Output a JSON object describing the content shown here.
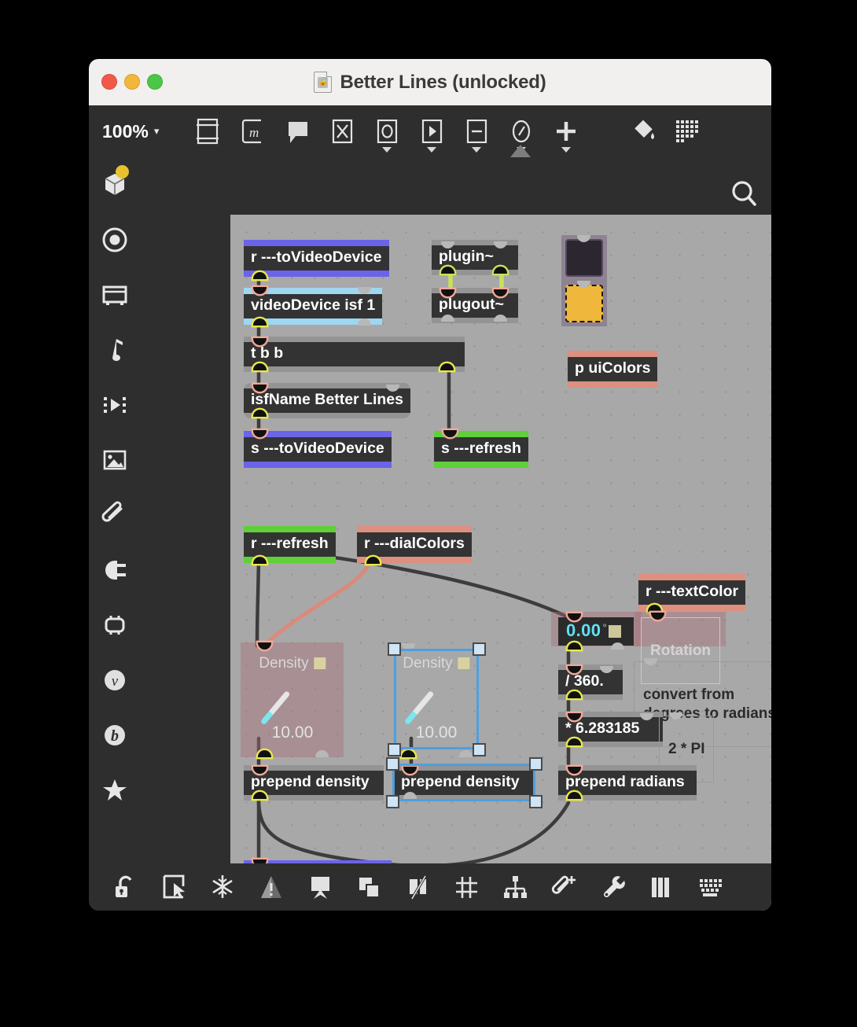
{
  "window": {
    "title": "Better Lines (unlocked)",
    "doc_icon": "document-unlocked-icon",
    "traffic": {
      "close": "close",
      "minimize": "minimize",
      "zoom": "zoom"
    }
  },
  "toolbar": {
    "zoom_level": "100%",
    "zoom_caret": "▾",
    "items": [
      {
        "name": "patcher-window-icon",
        "caret": false
      },
      {
        "name": "message-m-icon",
        "caret": false
      },
      {
        "name": "comment-icon",
        "caret": false
      },
      {
        "name": "object-x-icon",
        "caret": false
      },
      {
        "name": "ui-object-o-icon",
        "caret": true
      },
      {
        "name": "play-object-icon",
        "caret": true
      },
      {
        "name": "audio-object-icon",
        "caret": true
      },
      {
        "name": "gauge-object-icon",
        "caret": true
      },
      {
        "name": "add-object-icon",
        "caret": true
      },
      {
        "name": "paint-bucket-icon",
        "caret": false
      },
      {
        "name": "grid-palette-icon",
        "caret": false
      }
    ]
  },
  "left_sidebar": {
    "items": [
      {
        "name": "packages-icon",
        "badge": true
      },
      {
        "name": "target-circle-icon",
        "badge": false
      },
      {
        "name": "device-icon",
        "badge": false
      },
      {
        "name": "music-note-icon",
        "badge": false
      },
      {
        "name": "video-filmstrip-icon",
        "badge": false
      },
      {
        "name": "image-icon",
        "badge": false
      },
      {
        "name": "paperclip-icon",
        "badge": false
      },
      {
        "name": "plug-icon",
        "badge": false
      },
      {
        "name": "chip-icon",
        "badge": false
      },
      {
        "name": "vizzie-v-icon",
        "badge": false
      },
      {
        "name": "bach-b-icon",
        "badge": false
      },
      {
        "name": "favorites-star-icon",
        "badge": false
      }
    ]
  },
  "right_sidebar": {
    "items": [
      {
        "name": "search-icon"
      },
      {
        "name": "info-icon"
      },
      {
        "name": "two-pane-icon"
      },
      {
        "name": "list-icon"
      },
      {
        "name": "snapshot-camera-icon"
      },
      {
        "name": "mixer-sliders-icon"
      }
    ]
  },
  "bottom_toolbar": {
    "items": [
      {
        "name": "unlock-icon"
      },
      {
        "name": "pointer-frame-icon"
      },
      {
        "name": "snowflake-icon"
      },
      {
        "name": "warning-triangle-icon"
      },
      {
        "name": "presentation-icon"
      },
      {
        "name": "duplicate-icon"
      },
      {
        "name": "segmented-patchcord-icon"
      },
      {
        "name": "grid-icon"
      },
      {
        "name": "distribute-icon"
      },
      {
        "name": "add-clipping-icon"
      },
      {
        "name": "wrench-icon"
      },
      {
        "name": "piano-keys-icon"
      },
      {
        "name": "keyboard-icon"
      }
    ]
  },
  "patcher": {
    "objects": {
      "r_to_video_device": {
        "text": "r ---toVideoDevice",
        "band": "#6b63e8"
      },
      "video_device": {
        "text": "videoDevice isf 1",
        "band": "#9fd6f0"
      },
      "t_b_b": {
        "text": "t b b"
      },
      "isf_name": {
        "text": "isfName Better Lines"
      },
      "s_to_video_device": {
        "text": "s ---toVideoDevice",
        "band": "#6b63e8"
      },
      "s_refresh": {
        "text": "s ---refresh",
        "band": "#5fcf3a"
      },
      "plugin": {
        "text": "plugin~"
      },
      "plugout": {
        "text": "plugout~"
      },
      "p_ui_colors": {
        "text": "p uiColors",
        "band": "#dd8f80"
      },
      "r_refresh": {
        "text": "r ---refresh",
        "band": "#5fcf3a"
      },
      "r_dial_colors": {
        "text": "r ---dialColors",
        "band": "#dd8f80"
      },
      "r_text_color": {
        "text": "r ---textColor",
        "band": "#dd8f80"
      },
      "rotation_comment": {
        "text": "Rotation"
      },
      "degrees_comment": {
        "text": "convert from\ndegrees to radians:"
      },
      "two_pi_comment": {
        "text": "2 * PI"
      },
      "div_360": {
        "text": "/ 360."
      },
      "mul_tau": {
        "text": "* 6.283185"
      },
      "prepend_density_1": {
        "text": "prepend density"
      },
      "prepend_density_2": {
        "text": "prepend density"
      },
      "prepend_radians": {
        "text": "prepend radians"
      },
      "dial_1": {
        "label": "Density",
        "value": "10.00"
      },
      "dial_2": {
        "label": "Density",
        "value": "10.00"
      },
      "numberbox_rotation": {
        "value": "0.00",
        "unit": "°"
      },
      "swatch_dark": {
        "color": "#2b2630"
      },
      "swatch_amber": {
        "color": "#efb73c"
      }
    },
    "colors": {
      "canvas": "#a8a8a8",
      "object_fill": "#333333",
      "object_text": "#ffffff",
      "send_receive_blue": "#6b63e8",
      "refresh_green": "#5fcf3a",
      "dialcolors_salmon": "#dd8f80",
      "videodevice_cyan": "#9fd6f0",
      "selection_blue": "#4d9fe0",
      "number_cyan": "#5fe0f5",
      "signal_cord": "#c9e15c"
    }
  }
}
